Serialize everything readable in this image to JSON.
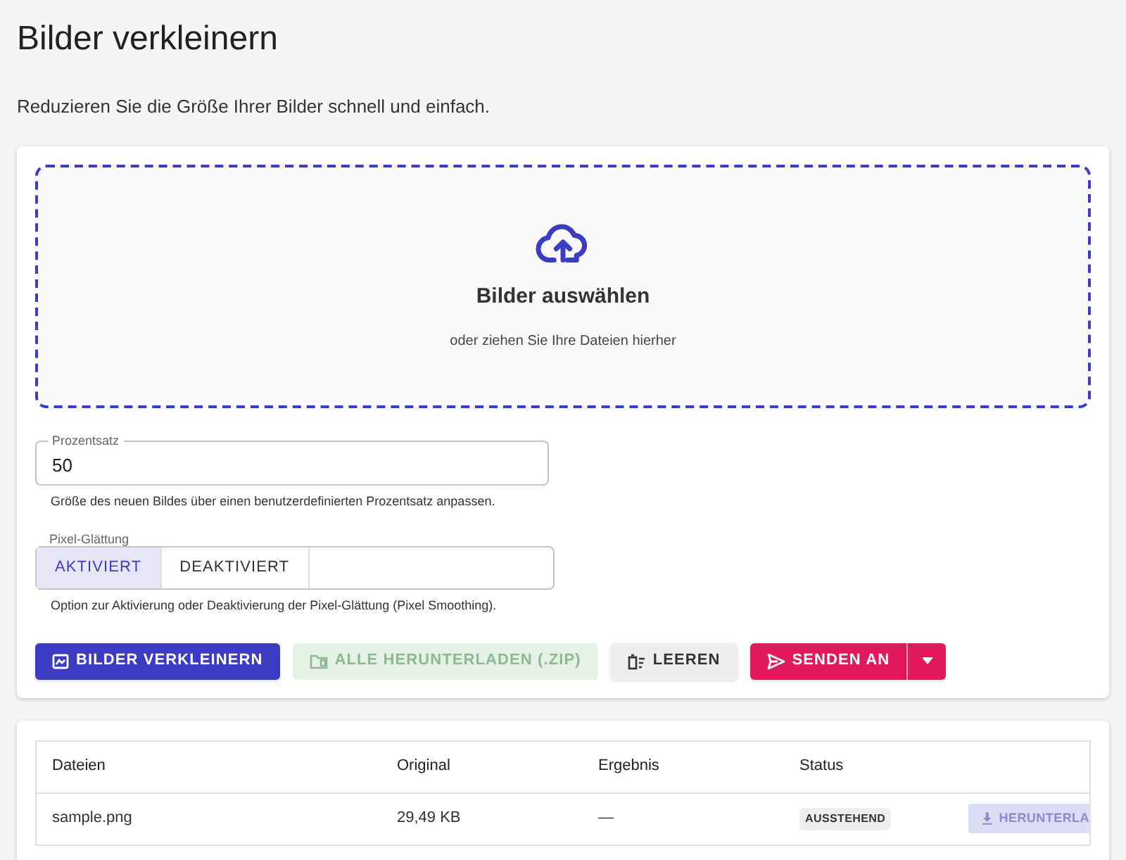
{
  "title": "Bilder verkleinern",
  "subtitle": "Reduzieren Sie die Größe Ihrer Bilder schnell und einfach.",
  "dropzone": {
    "title": "Bilder auswählen",
    "hint": "oder ziehen Sie Ihre Dateien hierher"
  },
  "percent_field": {
    "label": "Prozentsatz",
    "value": "50",
    "helper": "Größe des neuen Bildes über einen benutzerdefinierten Prozentsatz anpassen."
  },
  "smoothing": {
    "label": "Pixel-Glättung",
    "options": [
      {
        "label": "AKTIVIERT",
        "selected": true
      },
      {
        "label": "DEAKTIVIERT",
        "selected": false
      }
    ],
    "helper": "Option zur Aktivierung oder Deaktivierung der Pixel-Glättung (Pixel Smoothing)."
  },
  "buttons": [
    {
      "kind": "resize",
      "label": "BILDER VERKLEINERN",
      "disabled": false
    },
    {
      "kind": "zip",
      "label": "ALLE HERUNTERLADEN (.ZIP)",
      "disabled": true
    },
    {
      "kind": "clear",
      "label": "LEEREN",
      "disabled": false
    },
    {
      "kind": "send",
      "label": "SENDEN AN",
      "disabled": false
    }
  ],
  "table": {
    "columns": [
      "Dateien",
      "Original",
      "Ergebnis",
      "Status"
    ],
    "rows": [
      {
        "file": "sample.png",
        "original": "29,49 KB",
        "result": "—",
        "status": "AUSSTEHEND",
        "download": {
          "label": "HERUNTERLA",
          "disabled": true
        }
      }
    ]
  }
}
